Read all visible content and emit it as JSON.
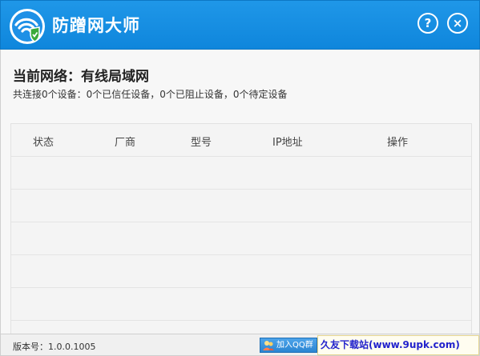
{
  "window": {
    "title": "防蹭网大师",
    "help_label": "?",
    "close_label": "×"
  },
  "network": {
    "heading": "当前网络：有线局域网",
    "summary": "共连接0个设备：0个已信任设备，0个已阻止设备，0个待定设备"
  },
  "table": {
    "columns": [
      "状态",
      "厂商",
      "型号",
      "IP地址",
      "操作"
    ],
    "rows": []
  },
  "footer": {
    "version": "版本号：1.0.0.1005",
    "qq_button_label": "加入QQ群",
    "watermark": "久友下载站(www.9upk.com)"
  },
  "colors": {
    "titlebar": "#1a8fe3",
    "background": "#f7f7f7"
  }
}
